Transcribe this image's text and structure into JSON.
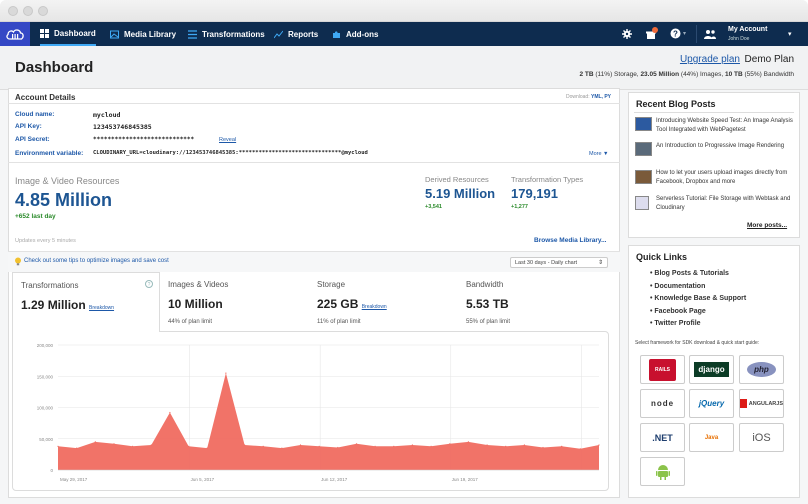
{
  "nav": {
    "items": [
      {
        "label": "Dashboard"
      },
      {
        "label": "Media Library"
      },
      {
        "label": "Transformations"
      },
      {
        "label": "Reports"
      },
      {
        "label": "Add-ons"
      }
    ],
    "account_label": "My Account",
    "account_user": "John Doe"
  },
  "header": {
    "title": "Dashboard",
    "upgrade_label": "Upgrade plan",
    "plan_name": "Demo Plan",
    "usage": {
      "storage_value": "2 TB",
      "storage_rest": " (11%) Storage, ",
      "images_value": "23.05 Million",
      "images_rest": " (44%) Images, ",
      "bandwidth_value": "10 TB",
      "bandwidth_rest": " (55%) Bandwidth"
    }
  },
  "account": {
    "title": "Account Details",
    "download_label": "Download:",
    "download_links": "YML, PY",
    "cloud_name_label": "Cloud name:",
    "cloud_name": "mycloud",
    "api_key_label": "API Key:",
    "api_key": "123453746845385",
    "api_secret_label": "API Secret:",
    "api_secret": "****************************",
    "reveal_label": "Reveal",
    "env_label": "Environment variable:",
    "env_value": "CLOUDINARY_URL=cloudinary://123453746845385:*******************************@mycloud",
    "more_label": "More ▼"
  },
  "resources": {
    "title": "Image & Video Resources",
    "value": "4.85 Million",
    "delta": "+652 last day",
    "derived_label": "Derived Resources",
    "derived_value": "5.19 Million",
    "derived_delta": "+3,541",
    "trans_types_label": "Transformation Types",
    "trans_types_value": "179,191",
    "trans_types_delta": "+1,277",
    "updates_note": "Updates every 5 minutes",
    "browse_label": "Browse Media Library..."
  },
  "tips": {
    "label": "Check out some tips to optimize images and save cost",
    "range_select": "Last 30 days - Daily chart"
  },
  "stat_tabs": [
    {
      "label": "Transformations",
      "value": "1.29 Million",
      "link": "Breakdown",
      "sub": ""
    },
    {
      "label": "Images & Videos",
      "value": "10 Million",
      "link": "",
      "sub": "44% of plan limit"
    },
    {
      "label": "Storage",
      "value": "225 GB",
      "link": "Breakdown",
      "sub": "11% of plan limit"
    },
    {
      "label": "Bandwidth",
      "value": "5.53 TB",
      "link": "",
      "sub": "55% of plan limit"
    }
  ],
  "chart_data": {
    "type": "area",
    "x_tick_labels": [
      "May 29, 2017",
      "Jun 5, 2017",
      "Jun 12, 2017",
      "Jun 19, 2017"
    ],
    "y_tick_labels": [
      "0",
      "50,000",
      "100,000",
      "150,000",
      "200,000"
    ],
    "ylim": [
      0,
      200000
    ],
    "values": [
      38000,
      35000,
      45000,
      42000,
      38000,
      40000,
      92000,
      38000,
      35000,
      155000,
      40000,
      38000,
      35000,
      40000,
      38000,
      36000,
      42000,
      38000,
      38000,
      40000,
      38000,
      42000,
      45000,
      40000,
      38000,
      40000,
      36000,
      38000,
      34000,
      40000
    ],
    "color": "#f06b60",
    "grid": true
  },
  "blog": {
    "title": "Recent Blog Posts",
    "posts": [
      "Introducing Website Speed Test: An Image Analysis Tool Integrated with WebPagetest",
      "An Introduction to Progressive Image Rendering",
      "How to let your users upload images directly from Facebook, Dropbox and more",
      "Serverless Tutorial: File Storage with Webtask and Cloudinary"
    ],
    "more_label": "More posts..."
  },
  "quick_links": {
    "title": "Quick Links",
    "items": [
      "Blog Posts & Tutorials",
      "Documentation",
      "Knowledge Base & Support",
      "Facebook Page",
      "Twitter Profile"
    ],
    "framework_note": "Select framework for SDK download & quick start guide:",
    "frameworks": [
      "RAILS",
      "django",
      "php",
      "node",
      "jQuery",
      "ANGULARJS",
      ".NET",
      "Java",
      "iOS",
      "android"
    ]
  },
  "colors": {
    "nav_bg": "#0e2c4f",
    "accent": "#1d58a8",
    "chart": "#f06b60",
    "positive": "#2a8a2a"
  }
}
